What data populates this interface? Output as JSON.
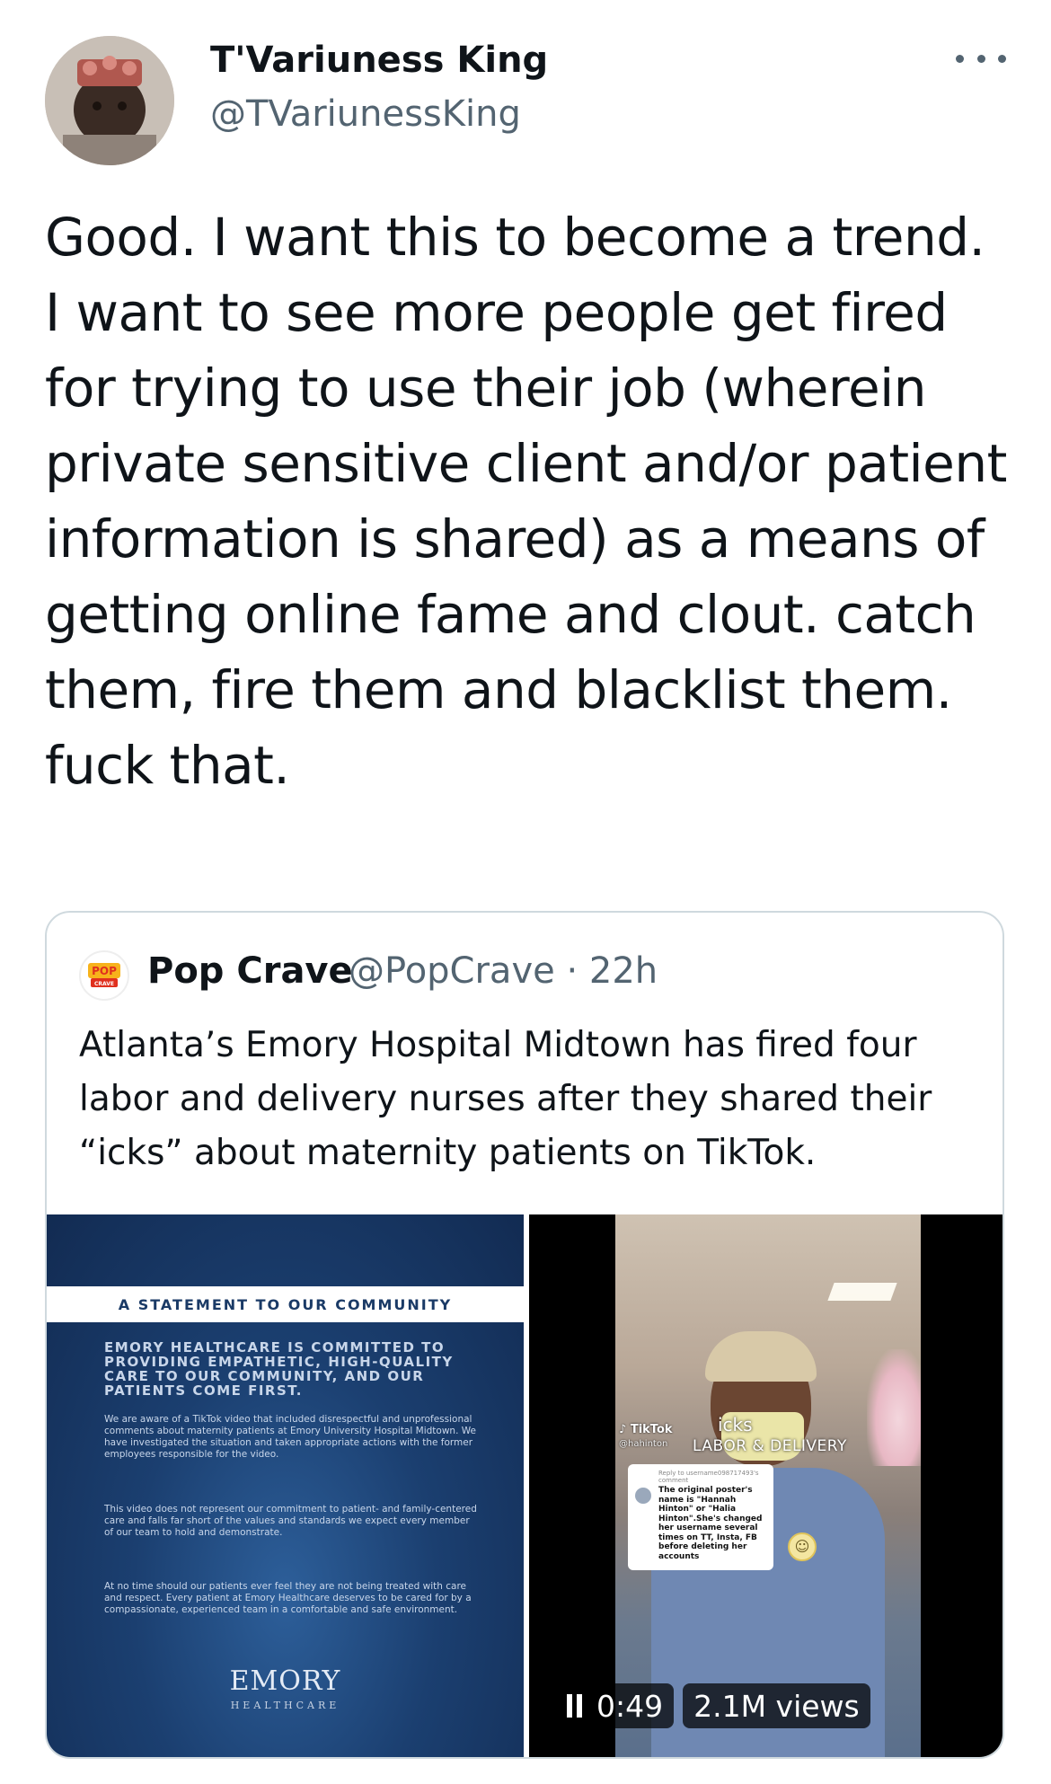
{
  "tweet": {
    "author": {
      "display_name": "T'Variuness King",
      "handle": "@TVariunessKing",
      "avatar_icon": "profile-avatar"
    },
    "more_icon": "more-options-icon",
    "text": "Good. I want this to become a trend. I want to see more people get fired for trying to use their job (wherein private sensitive client and/or patient information is shared) as a means of getting online fame and clout. catch them, fire them and blacklist them. fuck that."
  },
  "quoted_tweet": {
    "author": {
      "display_name": "Pop Crave",
      "handle_time": "@PopCrave · 22h",
      "avatar_text": "POP",
      "avatar_subtext": "CRAVE"
    },
    "text": "Atlanta’s Emory Hospital Midtown has fired four labor and delivery nurses after they shared their “icks” about maternity patients on TikTok.",
    "image_left": {
      "heading": "A STATEMENT TO OUR COMMUNITY",
      "headline": "EMORY HEALTHCARE IS COMMITTED TO PROVIDING EMPATHETIC, HIGH-QUALITY CARE TO OUR COMMUNITY, AND OUR PATIENTS COME FIRST.",
      "paragraph_1": "We are aware of a TikTok video that included disrespectful and unprofessional comments about maternity patients at Emory University Hospital Midtown. We have investigated the situation and taken appropriate actions with the former employees responsible for the video.",
      "paragraph_2": "This video does not represent our commitment to patient- and family-centered care and falls far short of the values and standards we expect every member of our team to hold and demonstrate.",
      "paragraph_3": "At no time should our patients ever feel they are not being treated with care and respect. Every patient at Emory Healthcare deserves to be cared for by a compassionate, experienced team in a comfortable and safe environment.",
      "logo": "EMORY",
      "logo_sub": "HEALTHCARE"
    },
    "video": {
      "tiktok_label": "TikTok",
      "tiktok_user": "@hahinton",
      "caption_icks": "icks",
      "caption_dept": "LABOR & DELIVERY",
      "reply_meta": "Reply to username098717493's comment",
      "reply_text": "The original poster's name is \"Hannah Hinton\" or \"Halia Hinton\".She's changed her username several times on TT, Insta, FB before deleting her accounts",
      "smiley": "☺",
      "time": "0:49",
      "views": "2.1M views",
      "pause_icon": "pause-icon"
    }
  },
  "colors": {
    "text": "#0f1419",
    "secondary": "#536471",
    "border": "#cfd9de",
    "emory_blue": "#1b3f70"
  }
}
